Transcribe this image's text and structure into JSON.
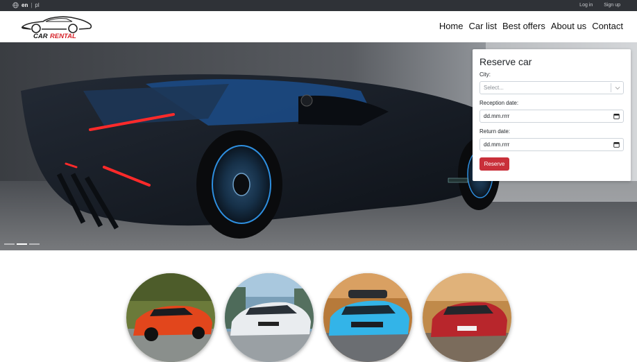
{
  "topbar": {
    "languages": [
      {
        "code": "en",
        "active": true
      },
      {
        "code": "pl",
        "active": false
      }
    ],
    "separator": "|",
    "login_label": "Log in",
    "signup_label": "Sign up"
  },
  "header": {
    "logo_text_car": "CAR",
    "logo_text_rental": "RENTAL",
    "nav": [
      "Home",
      "Car list",
      "Best offers",
      "About us",
      "Contact"
    ]
  },
  "hero": {
    "slides_count": 3,
    "active_slide": 2
  },
  "reserve": {
    "title": "Reserve car",
    "city_label": "City:",
    "city_placeholder": "Select...",
    "reception_label": "Reception date:",
    "reception_value": "dd.mm.rrrr",
    "return_label": "Return date:",
    "return_value": "dd.mm.rrrr",
    "button_label": "Reserve"
  },
  "colors": {
    "topbar_bg": "#2f3237",
    "accent_red": "#c9303a",
    "logo_red": "#d61f26"
  },
  "featured_cars": [
    {
      "color": "orange-red",
      "icon": "car-photo-1"
    },
    {
      "color": "white",
      "icon": "car-photo-2"
    },
    {
      "color": "light-blue",
      "icon": "car-photo-3"
    },
    {
      "color": "red",
      "icon": "car-photo-4"
    }
  ]
}
